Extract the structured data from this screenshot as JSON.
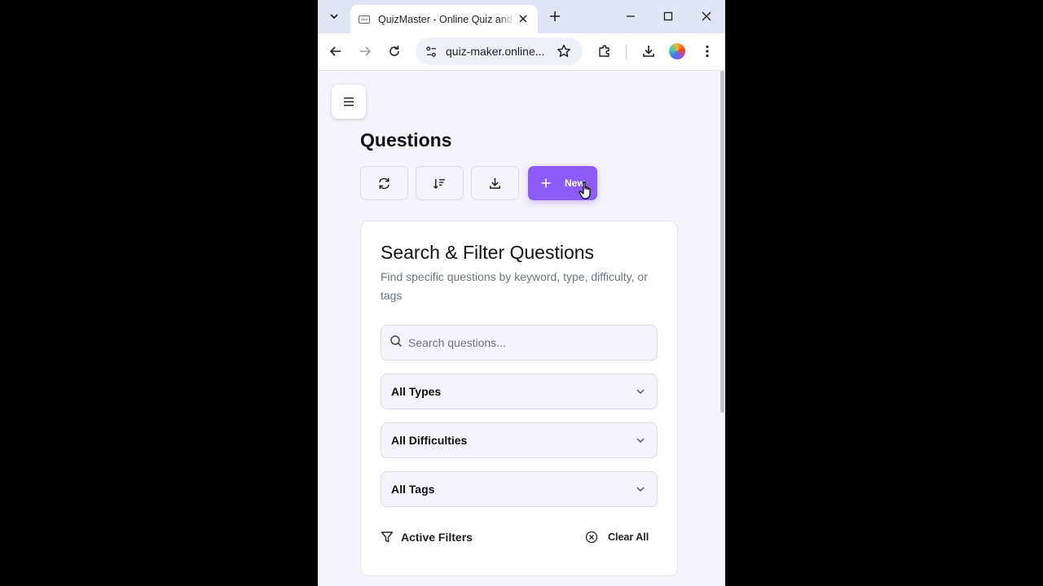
{
  "browser": {
    "tab_title": "QuizMaster - Online Quiz and AI",
    "favicon_text": "Quiz Maker",
    "url": "quiz-maker.online..."
  },
  "page": {
    "title": "Questions",
    "new_label": "New"
  },
  "filter_card": {
    "title": "Search & Filter Questions",
    "description": "Find specific questions by keyword, type, difficulty, or tags",
    "search_placeholder": "Search questions...",
    "type_select": "All Types",
    "difficulty_select": "All Difficulties",
    "tags_select": "All Tags",
    "active_filters_label": "Active Filters",
    "clear_all_label": "Clear All"
  },
  "colors": {
    "accent": "#8b5cf6",
    "page_bg": "#f5f3fb",
    "tabstrip_bg": "#dfe5f3"
  }
}
